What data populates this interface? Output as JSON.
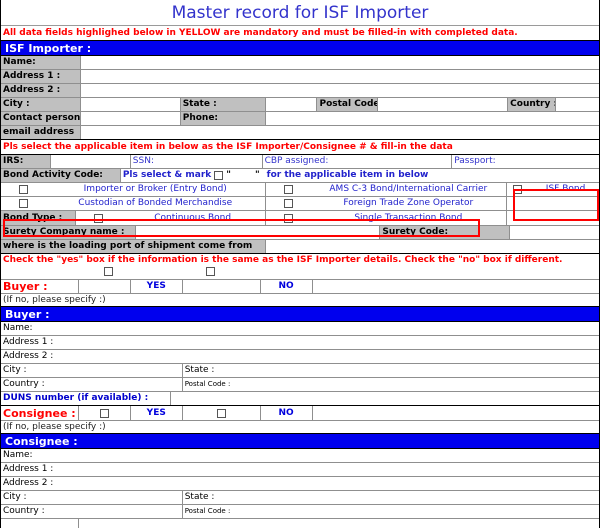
{
  "title": "Master record for ISF Importer",
  "mandatory_notice": "All data fields highlighed below in YELLOW are mandatory and must be filled-in with completed data.",
  "isf_importer": {
    "section_title": "ISF Importer :",
    "name_label": "Name:",
    "address1_label": "Address 1 :",
    "address2_label": "Address 2 :",
    "city_label": "City :",
    "state_label": "State :",
    "postal_label": "Postal Code",
    "country_label": "Country :",
    "contact_label": "Contact person",
    "phone_label": "Phone:",
    "email_label": "email address",
    "name_value": "",
    "address1_value": "",
    "address2_value": "",
    "city_value": "",
    "state_value": "",
    "postal_value": "",
    "country_value": "",
    "contact_value": "",
    "phone_value": "",
    "email_value": ""
  },
  "identifiers": {
    "instruction": "Pls select the applicable item in below as the ISF Importer/Consignee # & fill-in the data",
    "irs_label": "IRS:",
    "ssn_label": "SSN:",
    "cbp_label": "CBP assigned:",
    "passport_label": "Passport:",
    "irs_value": "",
    "ssn_value": "",
    "cbp_value": "",
    "passport_value": ""
  },
  "bond_activity": {
    "label": "Bond Activity Code:",
    "instruction_before": "Pls select & mark",
    "quote_open": "\"",
    "quote_close": "\"",
    "instruction_after": "for the applicable item in below",
    "options": [
      {
        "label": "Importer or Broker (Entry Bond)",
        "checked": false
      },
      {
        "label": "AMS C-3 Bond/International Carrier",
        "checked": false
      },
      {
        "label": "ISF Bond",
        "checked": false
      },
      {
        "label": "Custodian of Bonded Merchandise",
        "checked": false
      },
      {
        "label": "Foreign Trade Zone Operator",
        "checked": false
      }
    ]
  },
  "bond_type": {
    "label": "Bond Type :",
    "options": [
      {
        "label": "Continuous Bond",
        "checked": false
      },
      {
        "label": "Single Transaction Bond",
        "checked": false
      }
    ]
  },
  "surety": {
    "company_label": "Surety Company name :",
    "company_value": "",
    "code_label": "Surety Code:",
    "code_value": ""
  },
  "loading_port": {
    "label": "where is the loading port of shipment come from",
    "value": ""
  },
  "same_as_notice": "Check the \"yes\" box if the information is the same as the ISF Importer details.   Check the \"no\" box if different.",
  "buyer_check": {
    "label": "Buyer :",
    "yes_label": "YES",
    "no_label": "NO",
    "yes_checked": false,
    "no_checked": false,
    "if_no_label": "(If no, please specify :)",
    "if_no_value": ""
  },
  "buyer": {
    "section_title": "Buyer :",
    "name_label": "Name:",
    "address1_label": "Address 1 :",
    "address2_label": "Address 2 :",
    "city_label": "City :",
    "state_label": "State :",
    "country_label": "Country :",
    "postal_label": "Postal Code :",
    "duns_label": "DUNS number (if available) :",
    "name_value": "",
    "address1_value": "",
    "address2_value": "",
    "city_value": "",
    "state_value": "",
    "country_value": "",
    "postal_value": "",
    "duns_value": ""
  },
  "consignee_check": {
    "label": "Consignee :",
    "yes_label": "YES",
    "no_label": "NO",
    "yes_checked": false,
    "no_checked": false,
    "if_no_label": "(If no, please specify :)",
    "if_no_value": ""
  },
  "consignee": {
    "section_title": "Consignee :",
    "name_label": "Name:",
    "address1_label": "Address 1 :",
    "address2_label": "Address 2 :",
    "city_label": "City :",
    "state_label": "State :",
    "country_label": "Country :",
    "postal_label": "Postal Code :",
    "name_value": "",
    "address1_value": "",
    "address2_value": "",
    "city_value": "",
    "state_value": "",
    "country_value": "",
    "postal_value": ""
  },
  "colors": {
    "section_header_bg": "#0000ee",
    "label_bg": "#c0c0c0",
    "alert_red": "#ff0000",
    "link_blue": "#2222cc",
    "title_blue": "#3333cc"
  }
}
